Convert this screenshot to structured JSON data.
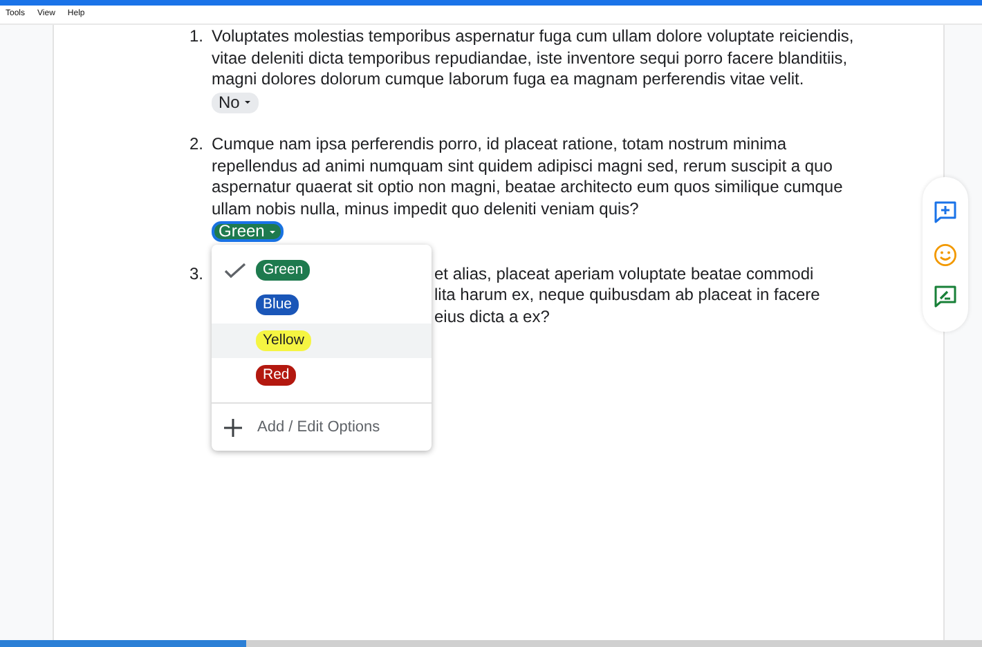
{
  "menu": [
    "Tools",
    "View",
    "Help"
  ],
  "questions": [
    {
      "number": "1.",
      "lines": [
        "Voluptates molestias temporibus aspernatur fuga cum ullam dolore voluptate reiciendis,",
        "vitae deleniti dicta temporibus repudiandae, iste inventore sequi porro facere blanditiis,",
        "magni dolores dolorum cumque laborum fuga ea magnam perferendis vitae velit."
      ],
      "answer": {
        "label": "No",
        "color": "#e8eaed",
        "focused": false
      }
    },
    {
      "number": "2.",
      "lines": [
        "Cumque nam ipsa perferendis porro, id placeat ratione, totam nostrum minima",
        "repellendus ad animi numquam sint quidem adipisci magni sed, rerum suscipit a quo",
        "aspernatur quaerat sit optio non magni, beatae architecto eum quos similique cumque",
        "ullam nobis nulla, minus impedit quo deleniti veniam quis?"
      ],
      "answer": {
        "label": "Green",
        "color": "#1e7a4e",
        "focused": true
      }
    },
    {
      "number": "3.",
      "lines": [
        "et alias, placeat aperiam voluptate beatae commodi",
        "lita harum ex, neque quibusdam ab placeat in facere",
        "eius dicta a ex?"
      ]
    }
  ],
  "dropdown": {
    "options": [
      {
        "label": "Green",
        "color": "#1e7a4e",
        "selected": true,
        "hovered": false
      },
      {
        "label": "Blue",
        "color": "#1a56b8",
        "selected": false,
        "hovered": false
      },
      {
        "label": "Yellow",
        "color": "#f5f542",
        "selected": false,
        "hovered": true
      },
      {
        "label": "Red",
        "color": "#b3180f",
        "selected": false,
        "hovered": false
      }
    ],
    "action": "Add / Edit Options"
  }
}
